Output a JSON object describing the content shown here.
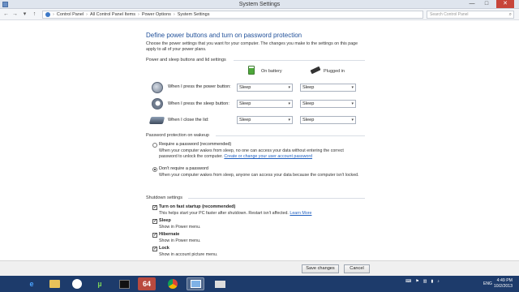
{
  "window": {
    "title": "System Settings",
    "minimize": "—",
    "maximize": "□",
    "close": "✕"
  },
  "addressbar": {
    "breadcrumbs": [
      "Control Panel",
      "All Control Panel Items",
      "Power Options",
      "System Settings"
    ],
    "search_placeholder": "Search Control Panel"
  },
  "page": {
    "heading": "Define power buttons and turn on password protection",
    "description": "Choose the power settings that you want for your computer. The changes you make to the settings on this page apply to all of your power plans."
  },
  "buttons_section": {
    "title": "Power and sleep buttons and lid settings",
    "col_battery": "On battery",
    "col_plugged": "Plugged in",
    "rows": [
      {
        "label": "When I press the power button:",
        "battery": "Sleep",
        "plugged": "Sleep"
      },
      {
        "label": "When I press the sleep button:",
        "battery": "Sleep",
        "plugged": "Sleep"
      },
      {
        "label": "When I close the lid:",
        "battery": "Sleep",
        "plugged": "Sleep"
      }
    ]
  },
  "password_section": {
    "title": "Password protection on wakeup",
    "options": [
      {
        "label": "Require a password (recommended)",
        "desc": "When your computer wakes from sleep, no one can access your data without entering the correct password to unlock the computer.",
        "link": "Create or change your user account password",
        "checked": false
      },
      {
        "label": "Don't require a password",
        "desc": "When your computer wakes from sleep, anyone can access your data because the computer isn't locked.",
        "link": "",
        "checked": true
      }
    ]
  },
  "shutdown_section": {
    "title": "Shutdown settings",
    "items": [
      {
        "label": "Turn on fast startup (recommended)",
        "desc": "This helps start your PC faster after shutdown. Restart isn't affected.",
        "link": "Learn More",
        "checked": true
      },
      {
        "label": "Sleep",
        "desc": "Show in Power menu.",
        "checked": true
      },
      {
        "label": "Hibernate",
        "desc": "Show in Power menu.",
        "checked": true
      },
      {
        "label": "Lock",
        "desc": "Show in account picture menu.",
        "checked": true
      }
    ]
  },
  "footer": {
    "save": "Save changes",
    "cancel": "Cancel"
  },
  "taskbar": {
    "items": [
      "ie",
      "explorer",
      "uTorrent",
      "utorrent-alt",
      "terminal",
      "64",
      "chrome",
      "control-panel",
      "mail"
    ],
    "clock_time": "4:49 PM",
    "clock_date": "10/2/2013",
    "language": "ENG"
  },
  "colors": {
    "heading": "#1f4f99",
    "link": "#1f5fbf",
    "taskbar": "#1d3b6b",
    "close": "#c7453a"
  }
}
